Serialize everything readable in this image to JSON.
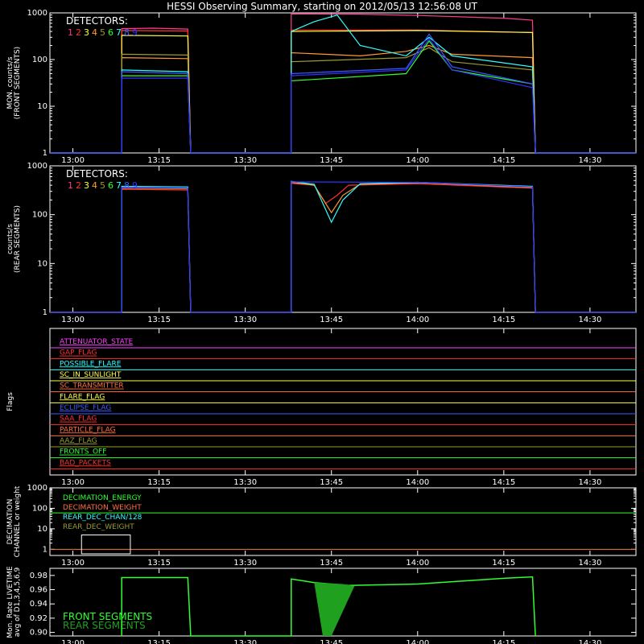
{
  "chart_data": {
    "type": "line",
    "title": "HESSI Observing Summary, starting on 2012/05/13 12:56:08 UT",
    "time_ticks": [
      "13:00",
      "13:15",
      "13:30",
      "13:45",
      "14:00",
      "14:15",
      "14:30"
    ],
    "time_tick_minutes": [
      0,
      15,
      30,
      45,
      60,
      75,
      90
    ],
    "x_range_minutes": [
      -4,
      98
    ],
    "detector_colors": [
      "#ff3c8c",
      "#ff3030",
      "#ffff40",
      "#ff9a30",
      "#9a9a30",
      "#30ff30",
      "#30ffff",
      "#3c5aff",
      "#3030ff"
    ],
    "panels": [
      {
        "id": "front",
        "ylabel": [
          "MON. counts/s",
          "(FRONT SEGMENTS)"
        ],
        "yscale": "log",
        "ylim": [
          1,
          1000
        ],
        "ytick_labels": [
          "1",
          "10",
          "100",
          "1000"
        ],
        "ytick_values": [
          1,
          10,
          100,
          1000
        ],
        "legend_title": "DETECTORS:",
        "legend_labels": [
          "1",
          "2",
          "3",
          "4",
          "5",
          "6",
          "7",
          "8",
          "9"
        ],
        "series": [
          {
            "name": "1",
            "values": [
              [
                -4,
                1
              ],
              [
                8.5,
                1
              ],
              [
                8.5,
                460
              ],
              [
                14,
                470
              ],
              [
                20,
                450
              ],
              [
                20.5,
                1
              ],
              [
                38,
                1
              ],
              [
                38,
                950
              ],
              [
                50,
                940
              ],
              [
                60,
                880
              ],
              [
                75,
                770
              ],
              [
                80,
                700
              ],
              [
                80.5,
                1
              ],
              [
                98,
                1
              ]
            ]
          },
          {
            "name": "2",
            "values": [
              [
                -4,
                1
              ],
              [
                8.5,
                1
              ],
              [
                8.5,
                420
              ],
              [
                20,
                410
              ],
              [
                20.5,
                1
              ],
              [
                38,
                1
              ],
              [
                38,
                430
              ],
              [
                60,
                430
              ],
              [
                80,
                380
              ],
              [
                80.5,
                1
              ],
              [
                98,
                1
              ]
            ]
          },
          {
            "name": "3",
            "values": [
              [
                -4,
                1
              ],
              [
                8.5,
                1
              ],
              [
                8.5,
                330
              ],
              [
                20,
                320
              ],
              [
                20.5,
                1
              ],
              [
                38,
                1
              ],
              [
                38,
                400
              ],
              [
                60,
                420
              ],
              [
                80,
                380
              ],
              [
                80.5,
                1
              ],
              [
                98,
                1
              ]
            ]
          },
          {
            "name": "4",
            "values": [
              [
                -4,
                1
              ],
              [
                8.5,
                1
              ],
              [
                8.5,
                110
              ],
              [
                20,
                105
              ],
              [
                20.5,
                1
              ],
              [
                38,
                1
              ],
              [
                38,
                140
              ],
              [
                50,
                120
              ],
              [
                58,
                150
              ],
              [
                62,
                200
              ],
              [
                66,
                130
              ],
              [
                80,
                110
              ],
              [
                80.5,
                1
              ],
              [
                98,
                1
              ]
            ]
          },
          {
            "name": "5",
            "values": [
              [
                -4,
                1
              ],
              [
                8.5,
                1
              ],
              [
                8.5,
                130
              ],
              [
                20,
                125
              ],
              [
                20.5,
                1
              ],
              [
                38,
                1
              ],
              [
                38,
                90
              ],
              [
                58,
                110
              ],
              [
                62,
                180
              ],
              [
                66,
                90
              ],
              [
                80,
                60
              ],
              [
                80.5,
                1
              ],
              [
                98,
                1
              ]
            ]
          },
          {
            "name": "6",
            "values": [
              [
                -4,
                1
              ],
              [
                8.5,
                1
              ],
              [
                8.5,
                45
              ],
              [
                20,
                45
              ],
              [
                20.5,
                1
              ],
              [
                38,
                1
              ],
              [
                38,
                35
              ],
              [
                58,
                50
              ],
              [
                62,
                250
              ],
              [
                66,
                60
              ],
              [
                80,
                30
              ],
              [
                80.5,
                1
              ],
              [
                98,
                1
              ]
            ]
          },
          {
            "name": "7",
            "values": [
              [
                -4,
                1
              ],
              [
                8.5,
                1
              ],
              [
                8.5,
                60
              ],
              [
                20,
                55
              ],
              [
                20.5,
                1
              ],
              [
                38,
                1
              ],
              [
                38,
                400
              ],
              [
                42,
                650
              ],
              [
                46,
                900
              ],
              [
                50,
                200
              ],
              [
                58,
                120
              ],
              [
                62,
                300
              ],
              [
                66,
                120
              ],
              [
                80,
                70
              ],
              [
                80.5,
                1
              ],
              [
                98,
                1
              ]
            ]
          },
          {
            "name": "8",
            "values": [
              [
                -4,
                1
              ],
              [
                8.5,
                1
              ],
              [
                8.5,
                55
              ],
              [
                20,
                50
              ],
              [
                20.5,
                1
              ],
              [
                38,
                1
              ],
              [
                38,
                50
              ],
              [
                58,
                65
              ],
              [
                62,
                350
              ],
              [
                66,
                70
              ],
              [
                80,
                30
              ],
              [
                80.5,
                1
              ],
              [
                98,
                1
              ]
            ]
          },
          {
            "name": "9",
            "values": [
              [
                -4,
                1
              ],
              [
                8.5,
                1
              ],
              [
                8.5,
                40
              ],
              [
                20,
                40
              ],
              [
                20.5,
                1
              ],
              [
                38,
                1
              ],
              [
                38,
                45
              ],
              [
                58,
                60
              ],
              [
                62,
                280
              ],
              [
                66,
                60
              ],
              [
                80,
                25
              ],
              [
                80.5,
                1
              ],
              [
                98,
                1
              ]
            ]
          }
        ]
      },
      {
        "id": "rear",
        "ylabel": [
          "counts/s",
          "(REAR SEGMENTS)"
        ],
        "yscale": "log",
        "ylim": [
          1,
          1000
        ],
        "ytick_labels": [
          "1",
          "10",
          "100",
          "1000"
        ],
        "ytick_values": [
          1,
          10,
          100,
          1000
        ],
        "legend_title": "DETECTORS:",
        "legend_labels": [
          "1",
          "2",
          "3",
          "4",
          "5",
          "6",
          "7",
          "8",
          "9"
        ],
        "series": [
          {
            "name": "2",
            "values": [
              [
                -4,
                1
              ],
              [
                8.5,
                1
              ],
              [
                8.5,
                330
              ],
              [
                20,
                320
              ],
              [
                20.5,
                1
              ],
              [
                38,
                1
              ],
              [
                38,
                440
              ],
              [
                42,
                400
              ],
              [
                44,
                170
              ],
              [
                46,
                250
              ],
              [
                48,
                400
              ],
              [
                60,
                430
              ],
              [
                80,
                350
              ],
              [
                80.5,
                1
              ],
              [
                98,
                1
              ]
            ]
          },
          {
            "name": "4",
            "values": [
              [
                -4,
                1
              ],
              [
                8.5,
                1
              ],
              [
                8.5,
                350
              ],
              [
                20,
                340
              ],
              [
                20.5,
                1
              ],
              [
                38,
                1
              ],
              [
                38,
                460
              ],
              [
                42,
                400
              ],
              [
                45,
                110
              ],
              [
                47,
                250
              ],
              [
                50,
                420
              ],
              [
                60,
                450
              ],
              [
                80,
                360
              ],
              [
                80.5,
                1
              ],
              [
                98,
                1
              ]
            ]
          },
          {
            "name": "7",
            "values": [
              [
                -4,
                1
              ],
              [
                8.5,
                1
              ],
              [
                8.5,
                380
              ],
              [
                20,
                370
              ],
              [
                20.5,
                1
              ],
              [
                38,
                1
              ],
              [
                38,
                480
              ],
              [
                42,
                420
              ],
              [
                45,
                70
              ],
              [
                47,
                200
              ],
              [
                50,
                430
              ],
              [
                60,
                460
              ],
              [
                80,
                380
              ],
              [
                80.5,
                1
              ],
              [
                98,
                1
              ]
            ]
          },
          {
            "name": "9",
            "values": [
              [
                -4,
                1
              ],
              [
                8.5,
                1
              ],
              [
                8.5,
                360
              ],
              [
                20,
                350
              ],
              [
                20.5,
                1
              ],
              [
                38,
                1
              ],
              [
                38,
                470
              ],
              [
                60,
                460
              ],
              [
                80,
                370
              ],
              [
                80.5,
                1
              ],
              [
                98,
                1
              ]
            ]
          }
        ]
      },
      {
        "id": "flags",
        "ylabel": [
          "Flags"
        ],
        "flags": [
          {
            "name": "ATTENUATOR_STATE",
            "color": "#ff40ff"
          },
          {
            "name": "GAP_FLAG",
            "color": "#ff3030"
          },
          {
            "name": "POSSIBLE_FLARE",
            "color": "#30ffff"
          },
          {
            "name": "SC_IN_SUNLIGHT",
            "color": "#ffff40"
          },
          {
            "name": "SC_TRANSMITTER",
            "color": "#ff7040"
          },
          {
            "name": "FLARE_FLAG",
            "color": "#ffff40"
          },
          {
            "name": "ECLIPSE_FLAG",
            "color": "#3c5aff"
          },
          {
            "name": "SAA_FLAG",
            "color": "#ff3030"
          },
          {
            "name": "PARTICLE_FLAG",
            "color": "#ff7040"
          },
          {
            "name": "AAZ_FLAG",
            "color": "#9a9a30"
          },
          {
            "name": "FRONTS_OFF",
            "color": "#30ff30"
          },
          {
            "name": "BAD_PACKETS",
            "color": "#ff3030"
          }
        ]
      },
      {
        "id": "decimation",
        "ylabel": [
          "DECIMATION",
          "CHANNEL or weight"
        ],
        "yscale": "log",
        "ylim": [
          0.5,
          1000
        ],
        "ytick_labels": [
          "1",
          "10",
          "100",
          "1000"
        ],
        "ytick_values": [
          1,
          10,
          100,
          1000
        ],
        "legend_labels": [
          "DECIMATION_ENERGY",
          "DECIMATION_WEIGHT",
          "REAR_DEC_CHAN/128",
          "REAR_DEC_WEIGHT"
        ],
        "legend_colors": [
          "#30ff30",
          "#ff7040",
          "#30ffff",
          "#9a9a30"
        ]
      },
      {
        "id": "livetime",
        "ylabel": [
          "Mon. Rate LIVETIME",
          "avg of D1,3,4,5,6,9"
        ],
        "ylim": [
          0.895,
          0.99
        ],
        "ytick_labels": [
          "0.90",
          "0.92",
          "0.94",
          "0.96",
          "0.98"
        ],
        "ytick_values": [
          0.9,
          0.92,
          0.94,
          0.96,
          0.98
        ],
        "legend_labels": [
          "FRONT SEGMENTS",
          "REAR SEGMENTS"
        ],
        "legend_colors": [
          "#30ff30",
          "#1fa01f"
        ]
      }
    ]
  }
}
